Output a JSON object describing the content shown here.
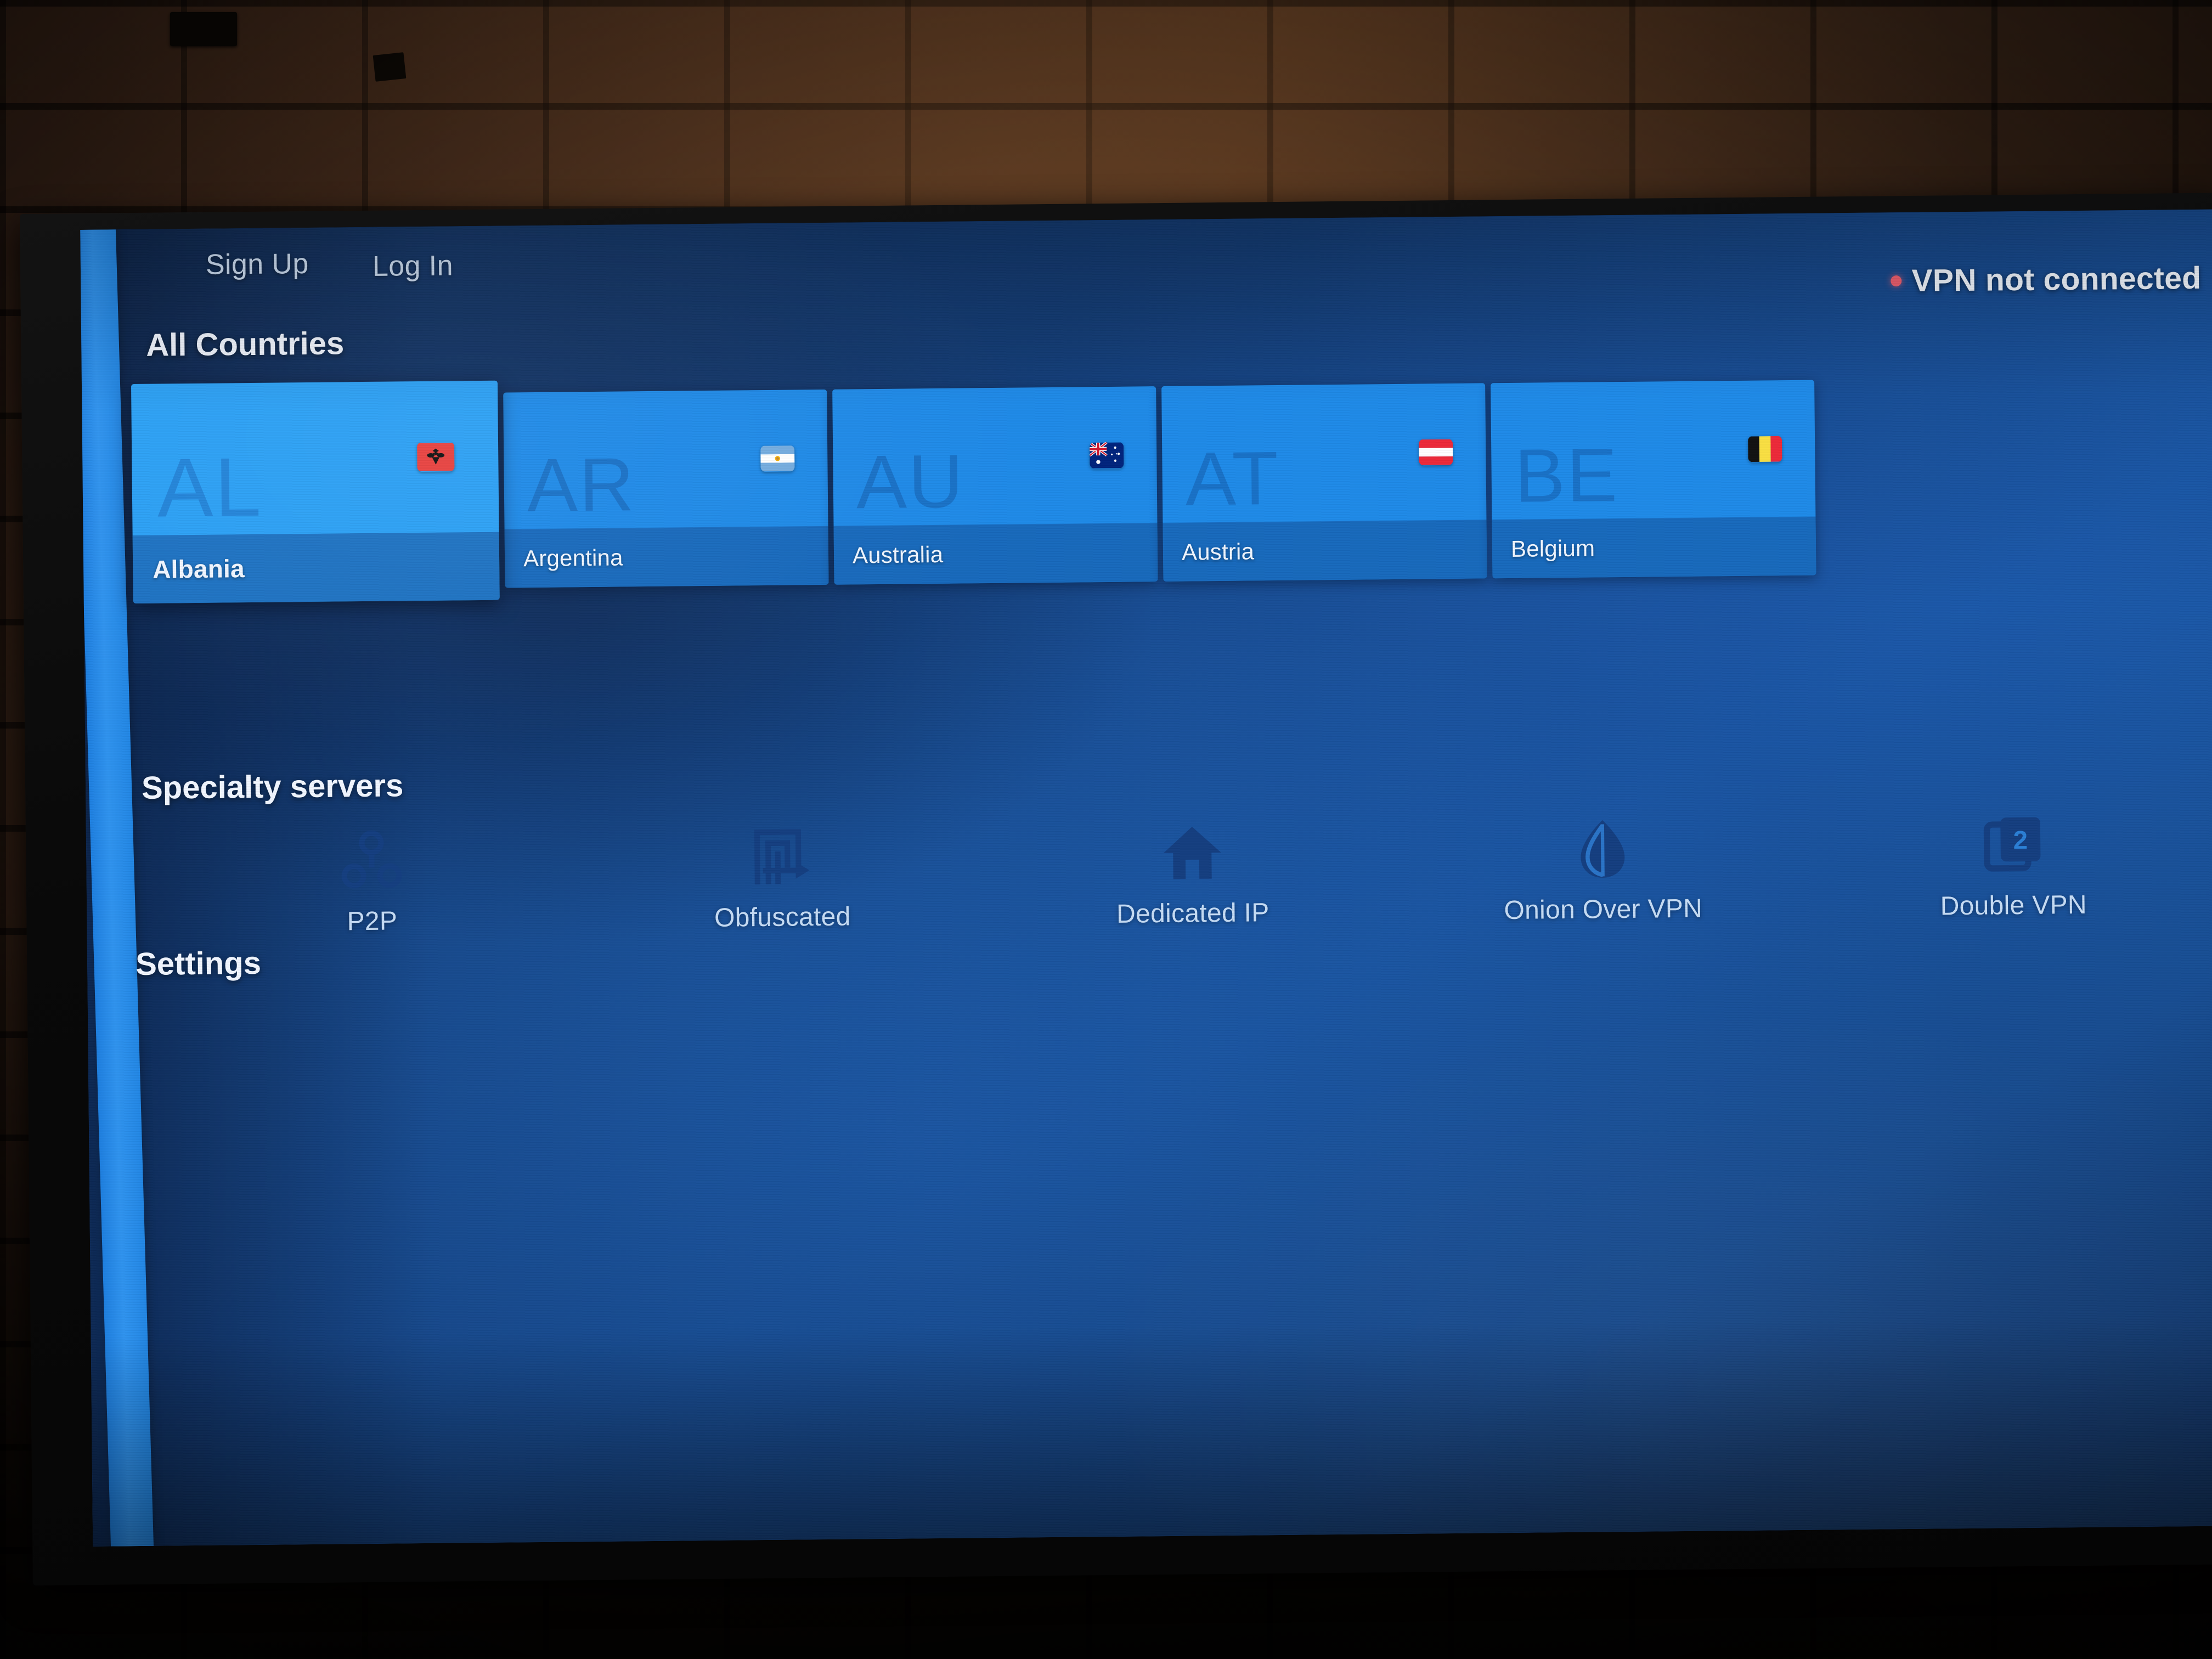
{
  "app": {
    "nav": {
      "sign_up": "Sign Up",
      "log_in": "Log In"
    },
    "status": {
      "text": "VPN not connected",
      "dot_color": "#ef5f6e",
      "connected": false
    },
    "sections": {
      "countries_title": "All Countries",
      "specialty_title": "Specialty servers",
      "settings_title": "Settings"
    },
    "countries": [
      {
        "code": "AL",
        "name": "Albania",
        "flag": "albania-flag",
        "focused": true
      },
      {
        "code": "AR",
        "name": "Argentina",
        "flag": "argentina-flag",
        "focused": false
      },
      {
        "code": "AU",
        "name": "Australia",
        "flag": "australia-flag",
        "focused": false
      },
      {
        "code": "AT",
        "name": "Austria",
        "flag": "austria-flag",
        "focused": false
      },
      {
        "code": "BE",
        "name": "Belgium",
        "flag": "belgium-flag",
        "focused": false
      }
    ],
    "specialty_servers": [
      {
        "label": "P2P",
        "icon": "p2p-nodes-icon"
      },
      {
        "label": "Obfuscated",
        "icon": "maze-arrow-icon"
      },
      {
        "label": "Dedicated IP",
        "icon": "house-icon"
      },
      {
        "label": "Onion Over VPN",
        "icon": "onion-icon"
      },
      {
        "label": "Double VPN",
        "icon": "double-square-two-icon"
      }
    ],
    "colors": {
      "accent_blue": "#2ba0f5",
      "card_blue": "#1e8ae8",
      "background_blue": "#1a58a8",
      "background_deep": "#123465",
      "status_red": "#ef5f6e",
      "rail_blue": "#2f93ef",
      "text_light": "#f1f6ff",
      "text_muted": "#c6dcf5"
    }
  }
}
